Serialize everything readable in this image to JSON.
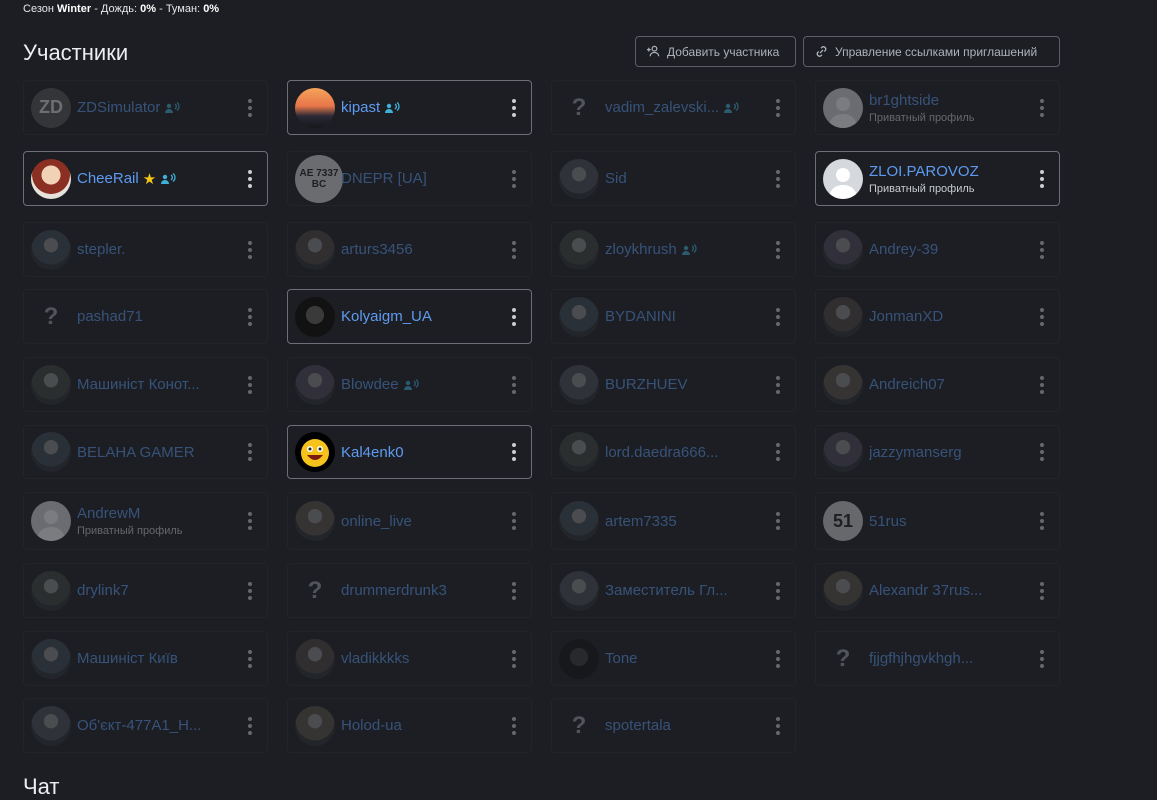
{
  "status": {
    "season_label": "Сезон",
    "season_value": "Winter",
    "rain_label": "Дождь:",
    "rain_value": "0%",
    "fog_label": "Туман:",
    "fog_value": "0%",
    "sep": "-"
  },
  "section": {
    "title": "Участники",
    "add_button": "Добавить участника",
    "invites_button": "Управление ссылками приглашений"
  },
  "chat_title": "Чат",
  "colors": {
    "background": "#1c1e23",
    "name_link": "#5e9bf0",
    "voice": "#3fb0d8",
    "star": "#f5c518"
  },
  "members": [
    {
      "name": "ZDSimulator",
      "sub": "",
      "voice": true,
      "star": false,
      "active": false,
      "avatar": "zd",
      "avatar_text": "ZD"
    },
    {
      "name": "kipast",
      "sub": "",
      "voice": true,
      "star": false,
      "active": true,
      "avatar": "sunset",
      "avatar_text": ""
    },
    {
      "name": "vadim_zalevski...",
      "sub": "",
      "voice": true,
      "star": false,
      "active": false,
      "avatar": "unknown",
      "avatar_text": "?"
    },
    {
      "name": "br1ghtside",
      "sub": "Приватный профиль",
      "voice": false,
      "star": false,
      "active": false,
      "avatar": "blank",
      "avatar_text": ""
    },
    {
      "name": "CheeRail",
      "sub": "",
      "voice": true,
      "star": true,
      "active": true,
      "avatar": "anime",
      "avatar_text": ""
    },
    {
      "name": "DNEPR [UA]",
      "sub": "",
      "voice": false,
      "star": false,
      "active": false,
      "avatar": "plate",
      "avatar_text": "AE 7337 BC"
    },
    {
      "name": "Sid",
      "sub": "",
      "voice": false,
      "star": false,
      "active": false,
      "avatar": "photo",
      "avatar_text": ""
    },
    {
      "name": "ZLOI.PAROVOZ",
      "sub": "Приватный профиль",
      "voice": false,
      "star": false,
      "active": true,
      "avatar": "blank",
      "avatar_text": ""
    },
    {
      "name": "stepler.",
      "sub": "",
      "voice": false,
      "star": false,
      "active": false,
      "avatar": "photo",
      "avatar_text": ""
    },
    {
      "name": "arturs3456",
      "sub": "",
      "voice": false,
      "star": false,
      "active": false,
      "avatar": "photo",
      "avatar_text": ""
    },
    {
      "name": "zloykhrush",
      "sub": "",
      "voice": true,
      "star": false,
      "active": false,
      "avatar": "photo",
      "avatar_text": ""
    },
    {
      "name": "Andrey-39",
      "sub": "",
      "voice": false,
      "star": false,
      "active": false,
      "avatar": "photo",
      "avatar_text": ""
    },
    {
      "name": "pashad71",
      "sub": "",
      "voice": false,
      "star": false,
      "active": false,
      "avatar": "unknown",
      "avatar_text": "?"
    },
    {
      "name": "Kolyaigm_UA",
      "sub": "",
      "voice": false,
      "star": false,
      "active": true,
      "avatar": "dark",
      "avatar_text": ""
    },
    {
      "name": "BYDANINI",
      "sub": "",
      "voice": false,
      "star": false,
      "active": false,
      "avatar": "photo",
      "avatar_text": ""
    },
    {
      "name": "JonmanXD",
      "sub": "",
      "voice": false,
      "star": false,
      "active": false,
      "avatar": "photo",
      "avatar_text": ""
    },
    {
      "name": "Машиніст Конот...",
      "sub": "",
      "voice": false,
      "star": false,
      "active": false,
      "avatar": "photo",
      "avatar_text": ""
    },
    {
      "name": "Blowdee",
      "sub": "",
      "voice": true,
      "star": false,
      "active": false,
      "avatar": "photo",
      "avatar_text": ""
    },
    {
      "name": "BURZHUEV",
      "sub": "",
      "voice": false,
      "star": false,
      "active": false,
      "avatar": "photo",
      "avatar_text": ""
    },
    {
      "name": "Andreich07",
      "sub": "",
      "voice": false,
      "star": false,
      "active": false,
      "avatar": "photo",
      "avatar_text": ""
    },
    {
      "name": "BELAHA GAMER",
      "sub": "",
      "voice": false,
      "star": false,
      "active": false,
      "avatar": "photo",
      "avatar_text": ""
    },
    {
      "name": "Kal4enk0",
      "sub": "",
      "voice": false,
      "star": false,
      "active": true,
      "avatar": "smiley",
      "avatar_text": ""
    },
    {
      "name": "lord.daedra666...",
      "sub": "",
      "voice": false,
      "star": false,
      "active": false,
      "avatar": "photo",
      "avatar_text": ""
    },
    {
      "name": "jazzymanserg",
      "sub": "",
      "voice": false,
      "star": false,
      "active": false,
      "avatar": "photo",
      "avatar_text": ""
    },
    {
      "name": "AndrewM",
      "sub": "Приватный профиль",
      "voice": false,
      "star": false,
      "active": false,
      "avatar": "blank",
      "avatar_text": ""
    },
    {
      "name": "online_live",
      "sub": "",
      "voice": false,
      "star": false,
      "active": false,
      "avatar": "photo",
      "avatar_text": ""
    },
    {
      "name": "artem7335",
      "sub": "",
      "voice": false,
      "star": false,
      "active": false,
      "avatar": "photo",
      "avatar_text": ""
    },
    {
      "name": "51rus",
      "sub": "",
      "voice": false,
      "star": false,
      "active": false,
      "avatar": "fiftyone",
      "avatar_text": "51"
    },
    {
      "name": "drylink7",
      "sub": "",
      "voice": false,
      "star": false,
      "active": false,
      "avatar": "photo",
      "avatar_text": ""
    },
    {
      "name": "drummerdrunk3",
      "sub": "",
      "voice": false,
      "star": false,
      "active": false,
      "avatar": "unknown",
      "avatar_text": "?"
    },
    {
      "name": "Заместитель Гл...",
      "sub": "",
      "voice": false,
      "star": false,
      "active": false,
      "avatar": "photo",
      "avatar_text": ""
    },
    {
      "name": "Alexandr 37rus...",
      "sub": "",
      "voice": false,
      "star": false,
      "active": false,
      "avatar": "photo",
      "avatar_text": ""
    },
    {
      "name": "Машиніст Київ",
      "sub": "",
      "voice": false,
      "star": false,
      "active": false,
      "avatar": "photo",
      "avatar_text": ""
    },
    {
      "name": "vladikkkks",
      "sub": "",
      "voice": false,
      "star": false,
      "active": false,
      "avatar": "photo",
      "avatar_text": ""
    },
    {
      "name": "Tone",
      "sub": "",
      "voice": false,
      "star": false,
      "active": false,
      "avatar": "dark",
      "avatar_text": ""
    },
    {
      "name": "fjjgfhjhgvkhgh...",
      "sub": "",
      "voice": false,
      "star": false,
      "active": false,
      "avatar": "unknown",
      "avatar_text": "?"
    },
    {
      "name": "Об'єкт-477А1_Н...",
      "sub": "",
      "voice": false,
      "star": false,
      "active": false,
      "avatar": "photo",
      "avatar_text": ""
    },
    {
      "name": "Holod-ua",
      "sub": "",
      "voice": false,
      "star": false,
      "active": false,
      "avatar": "photo",
      "avatar_text": ""
    },
    {
      "name": "spotertala",
      "sub": "",
      "voice": false,
      "star": false,
      "active": false,
      "avatar": "unknown",
      "avatar_text": "?"
    }
  ]
}
